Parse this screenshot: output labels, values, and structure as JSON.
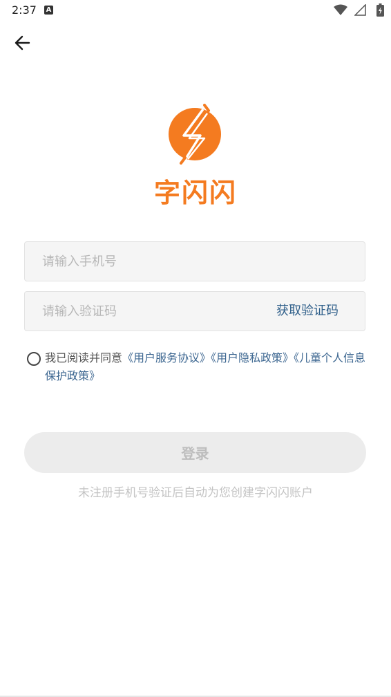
{
  "status_bar": {
    "time": "2:37",
    "notification_letter": "A",
    "icons": [
      "wifi-icon",
      "cell-signal-icon",
      "battery-charging-icon"
    ]
  },
  "nav": {
    "back_icon": "arrow-left-icon"
  },
  "brand": {
    "app_name": "字闪闪",
    "logo_icon": "lightning-logo-icon",
    "brand_color": "#f47b20"
  },
  "form": {
    "phone_placeholder": "请输入手机号",
    "phone_value": "",
    "code_placeholder": "请输入验证码",
    "code_value": "",
    "get_code_label": "获取验证码"
  },
  "agreement": {
    "checked": false,
    "prefix": "我已阅读并同意",
    "links": [
      "《用户服务协议》",
      "《用户隐私政策》",
      "《儿童个人信息保护政策》"
    ],
    "link_color": "#3d6791"
  },
  "login": {
    "button_label": "登录",
    "hint": "未注册手机号验证后自动为您创建字闪闪账户"
  }
}
